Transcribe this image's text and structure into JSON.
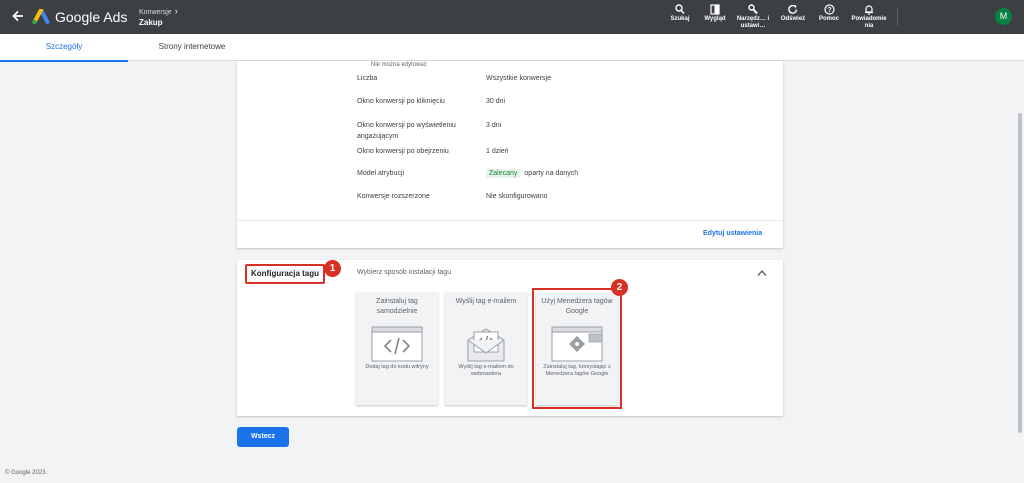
{
  "topbar": {
    "product_name": "Google Ads",
    "breadcrumb_parent": "Konwersje",
    "breadcrumb_current": "Zakup",
    "tools": [
      {
        "label": "Szukaj",
        "icon": "search-icon"
      },
      {
        "label": "Wygląd",
        "icon": "layout-icon"
      },
      {
        "label": "Narzędz… i ustawi…",
        "icon": "wrench-icon"
      },
      {
        "label": "Odśwież",
        "icon": "refresh-icon"
      },
      {
        "label": "Pomoc",
        "icon": "help-icon"
      },
      {
        "label": "Powiadomie nia",
        "icon": "bell-icon"
      }
    ],
    "avatar_initial": "M"
  },
  "tabs": [
    {
      "label": "Szczegóły",
      "active": true
    },
    {
      "label": "Strony internetowe",
      "active": false
    }
  ],
  "settings": {
    "non_editable_note": "Nie można edytować",
    "rows": [
      {
        "label": "Liczba",
        "value": "Wszystkie konwersje"
      },
      {
        "label": "Okno konwersji po kliknięciu",
        "value": "30 dni"
      },
      {
        "label": "Okno konwersji po wyświetleniu angażującym",
        "value": "3 dni"
      },
      {
        "label": "Okno konwersji po obejrzeniu",
        "value": "1 dzień"
      },
      {
        "label": "Model atrybucji",
        "chip": "Zalecany",
        "value": "oparty na danych"
      },
      {
        "label": "Konwersje rozszerzone",
        "value": "Nie skonfigurowano"
      }
    ],
    "edit_link": "Edytuj ustawienia"
  },
  "tag_config": {
    "heading": "Konfiguracja tagu",
    "subtitle": "Wybierz sposób instalacji tagu",
    "badge_1": "1",
    "badge_2": "2",
    "options": [
      {
        "title": "Zainstaluj tag samodzielnie",
        "description": "Dodaj tag do kodu witryny"
      },
      {
        "title": "Wyślij tag e-mailem",
        "description": "Wyślij tag e-mailem do webmastera"
      },
      {
        "title": "Użyj Menedżera tagów Google",
        "description": "Zainstaluj tag, korzystając z Menedżera tagów Google"
      }
    ]
  },
  "back_button": "Wstecz",
  "footer": "© Google 2023.",
  "colors": {
    "topbar": "#3c4043",
    "accent": "#1a73e8",
    "highlight": "#d93025",
    "background": "#f1f3f4"
  }
}
